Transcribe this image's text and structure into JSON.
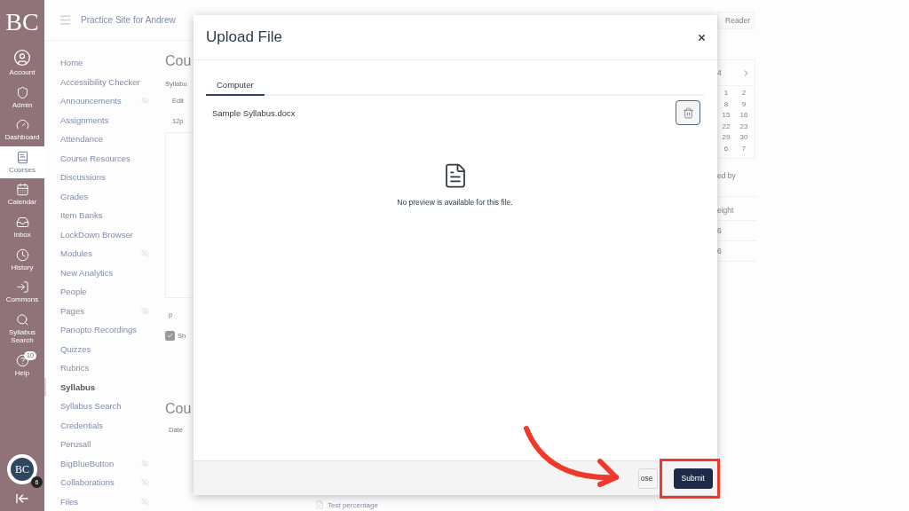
{
  "global_nav": {
    "logo": "BC",
    "items": [
      {
        "label": "Account",
        "selected": false
      },
      {
        "label": "Admin",
        "selected": false
      },
      {
        "label": "Dashboard",
        "selected": false
      },
      {
        "label": "Courses",
        "selected": true
      },
      {
        "label": "Calendar",
        "selected": false
      },
      {
        "label": "Inbox",
        "selected": false
      },
      {
        "label": "History",
        "selected": false
      },
      {
        "label": "Commons",
        "selected": false
      },
      {
        "label": "Syllabus Search",
        "selected": false
      },
      {
        "label": "Help",
        "selected": false,
        "badge": "10"
      }
    ],
    "avatar": {
      "initials": "BC",
      "badge": "6"
    }
  },
  "course_header": {
    "title": "Practice Site for Andrew"
  },
  "course_nav": [
    {
      "label": "Home",
      "selected": false,
      "hidden": false
    },
    {
      "label": "Accessibility Checker",
      "selected": false,
      "hidden": false
    },
    {
      "label": "Announcements",
      "selected": false,
      "hidden": true
    },
    {
      "label": "Assignments",
      "selected": false,
      "hidden": false
    },
    {
      "label": "Attendance",
      "selected": false,
      "hidden": false
    },
    {
      "label": "Course Resources",
      "selected": false,
      "hidden": false
    },
    {
      "label": "Discussions",
      "selected": false,
      "hidden": false
    },
    {
      "label": "Grades",
      "selected": false,
      "hidden": false
    },
    {
      "label": "Item Banks",
      "selected": false,
      "hidden": false
    },
    {
      "label": "LockDown Browser",
      "selected": false,
      "hidden": false
    },
    {
      "label": "Modules",
      "selected": false,
      "hidden": true
    },
    {
      "label": "New Analytics",
      "selected": false,
      "hidden": false
    },
    {
      "label": "People",
      "selected": false,
      "hidden": false
    },
    {
      "label": "Pages",
      "selected": false,
      "hidden": true
    },
    {
      "label": "Panopto Recordings",
      "selected": false,
      "hidden": false
    },
    {
      "label": "Quizzes",
      "selected": false,
      "hidden": false
    },
    {
      "label": "Rubrics",
      "selected": false,
      "hidden": false
    },
    {
      "label": "Syllabus",
      "selected": true,
      "hidden": false
    },
    {
      "label": "Syllabus Search",
      "selected": false,
      "hidden": false
    },
    {
      "label": "Credentials",
      "selected": false,
      "hidden": false
    },
    {
      "label": "Perusall",
      "selected": false,
      "hidden": false
    },
    {
      "label": "BigBlueButton",
      "selected": false,
      "hidden": true
    },
    {
      "label": "Collaborations",
      "selected": false,
      "hidden": true
    },
    {
      "label": "Files",
      "selected": false,
      "hidden": true
    }
  ],
  "main": {
    "heading": "Cou",
    "breadcrumb": "Syllabu",
    "edit_link": "Edit",
    "font_size": "12p",
    "path": "p",
    "checkbox": {
      "label": "Sh",
      "checked": true
    },
    "heading_2": "Cou",
    "column": "Date",
    "footer_item": "Test percentage"
  },
  "right": {
    "reader_button": "Reader",
    "calendar": {
      "month": "4",
      "rows": [
        [
          "1",
          "2"
        ],
        [
          "8",
          "9"
        ],
        [
          "15",
          "16"
        ],
        [
          "22",
          "23"
        ],
        [
          "29",
          "30"
        ],
        [
          "6",
          "7"
        ]
      ]
    },
    "text": "ed by",
    "column": "eight",
    "rows": [
      "6",
      "6"
    ]
  },
  "dialog": {
    "title": "Upload File",
    "tabs": [
      {
        "label": "Computer",
        "selected": true
      }
    ],
    "file_name": "Sample Syllabus.docx",
    "preview_message": "No preview is available for this file.",
    "buttons": [
      {
        "label": "ose",
        "kind": "secondary"
      },
      {
        "label": "Submit",
        "kind": "primary"
      }
    ]
  }
}
